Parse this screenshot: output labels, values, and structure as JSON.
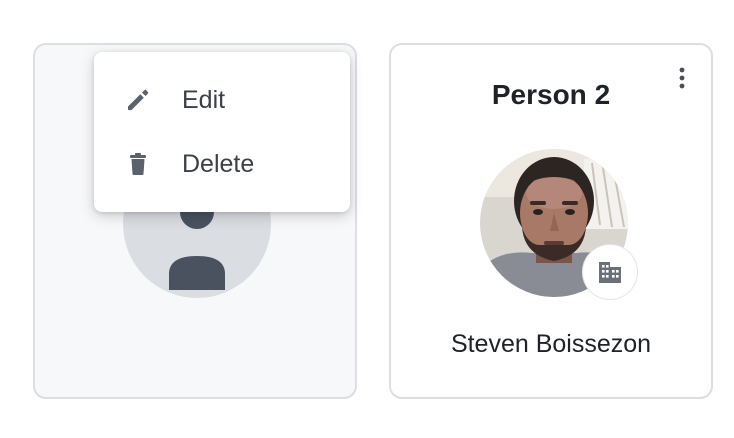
{
  "cards": [
    {
      "title": "",
      "avatar": "person-placeholder-icon"
    },
    {
      "title": "Person 2",
      "name": "Steven Boissezon",
      "avatar": "person-photo",
      "badge_icon": "building-icon",
      "menu_icon": "kebab-icon"
    }
  ],
  "context_menu": {
    "items": [
      {
        "label": "Edit",
        "icon": "pencil-icon"
      },
      {
        "label": "Delete",
        "icon": "trash-icon"
      }
    ]
  },
  "colors": {
    "card_border": "#dcdee2",
    "placeholder_bg": "#dadde2",
    "placeholder_fg": "#4a5260",
    "text_primary": "#1f2226",
    "menu_text": "#3c4048",
    "menu_icon": "#5c626c"
  }
}
